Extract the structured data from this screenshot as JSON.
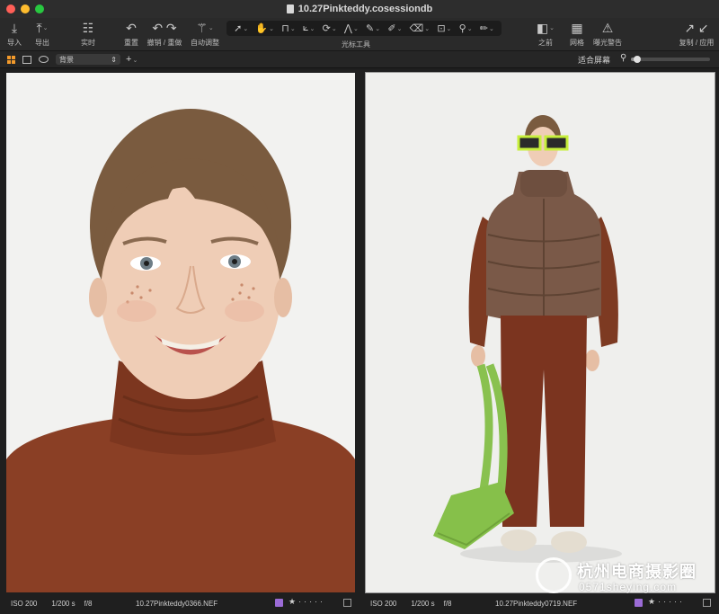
{
  "window": {
    "title": "10.27Pinkteddy.cosessiondb"
  },
  "toolbar": {
    "import": "导入",
    "export": "导出",
    "live": "实时",
    "reset": "重置",
    "undo_redo": "撤销 / 重做",
    "auto_adjust": "自动调整",
    "cursor_tools": "光标工具",
    "before": "之前",
    "grid": "网格",
    "exposure_warning": "曝光警告",
    "copy_apply": "复制 / 应用"
  },
  "viewerbar": {
    "background": "背景",
    "fit_screen": "适合屏幕",
    "zoom_level": 0.08
  },
  "photos": [
    {
      "iso": "ISO 200",
      "shutter": "1/200 s",
      "aperture": "f/8",
      "filename": "10.27Pinkteddy0366.NEF",
      "rating": 1,
      "color_tag": "#9b6bd6"
    },
    {
      "iso": "ISO 200",
      "shutter": "1/200 s",
      "aperture": "f/8",
      "filename": "10.27Pinkteddy0719.NEF",
      "rating": 1,
      "color_tag": "#9b6bd6"
    }
  ],
  "watermark": {
    "name": "杭州电商摄影圈",
    "url": "0571sheying.com"
  },
  "colors": {
    "accent": "#f39a2b",
    "background": "#1f1f1f",
    "photo_bg": "#eeeeec"
  }
}
